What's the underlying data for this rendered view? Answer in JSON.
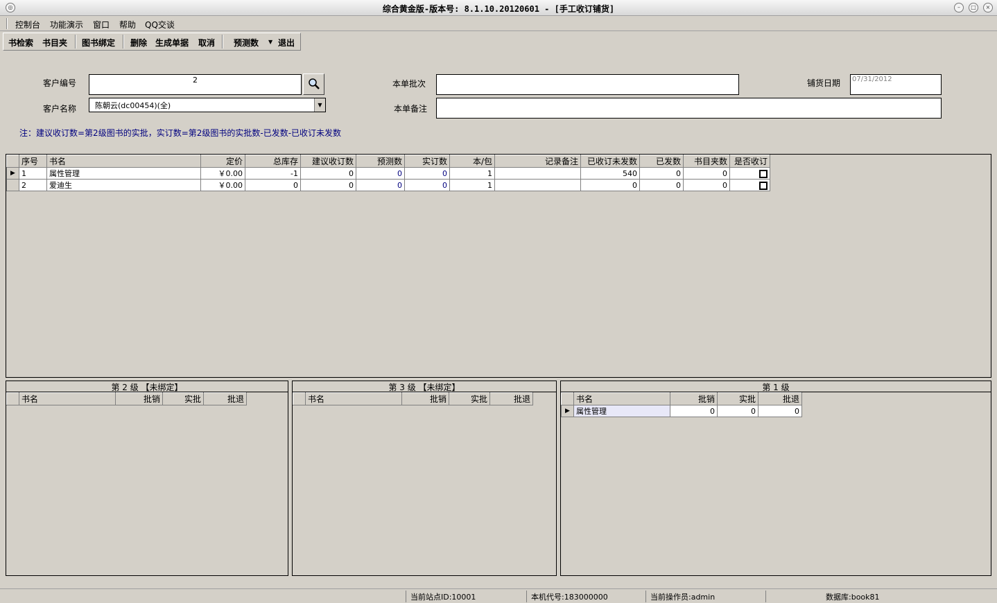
{
  "window": {
    "title": "综合黄金版-版本号: 8.1.10.20120601 - [手工收订铺货]"
  },
  "menu": [
    "控制台",
    "功能演示",
    "窗口",
    "帮助",
    "QQ交谈"
  ],
  "toolbar": {
    "search": "书检索",
    "folder": "书目夹",
    "bind": "图书绑定",
    "delete": "删除",
    "generate": "生成单据",
    "cancel": "取消",
    "forecast": "预测数",
    "exit": "退出"
  },
  "form": {
    "customer_no_label": "客户编号",
    "customer_no_value": "2",
    "customer_name_label": "客户名称",
    "customer_name_value": "陈朝云(dc00454)(全)",
    "batch_label": "本单批次",
    "batch_value": "",
    "remark_label": "本单备注",
    "remark_value": "",
    "date_label": "铺货日期",
    "date_value": "07/31/2012",
    "note": "注：建议收订数=第2级图书的实批，实订数=第2级图书的实批数-已发数-已收订未发数"
  },
  "main_grid": {
    "headers": [
      "序号",
      "书名",
      "定价",
      "总库存",
      "建议收订数",
      "预测数",
      "实订数",
      "本/包",
      "记录备注",
      "已收订未发数",
      "已发数",
      "书目夹数",
      "是否收订"
    ],
    "rows": [
      [
        "1",
        "属性管理",
        "￥0.00",
        "-1",
        "0",
        "0",
        "0",
        "1",
        "",
        "540",
        "0",
        "0",
        ""
      ],
      [
        "2",
        "爱迪生",
        "￥0.00",
        "0",
        "0",
        "0",
        "0",
        "1",
        "",
        "0",
        "0",
        "0",
        ""
      ]
    ]
  },
  "level2": {
    "title": "第 2 级 【未绑定】",
    "headers": [
      "书名",
      "批销",
      "实批",
      "批退"
    ]
  },
  "level3": {
    "title": "第 3 级 【未绑定】",
    "headers": [
      "书名",
      "批销",
      "实批",
      "批退"
    ]
  },
  "level1": {
    "title": "第 1 级",
    "headers": [
      "书名",
      "批销",
      "实批",
      "批退"
    ],
    "rows": [
      [
        "属性管理",
        "0",
        "0",
        "0"
      ]
    ]
  },
  "status": {
    "site": "当前站点ID:10001",
    "machine": "本机代号:183000000",
    "operator": "当前操作员:admin",
    "database": "数据库:book81"
  }
}
